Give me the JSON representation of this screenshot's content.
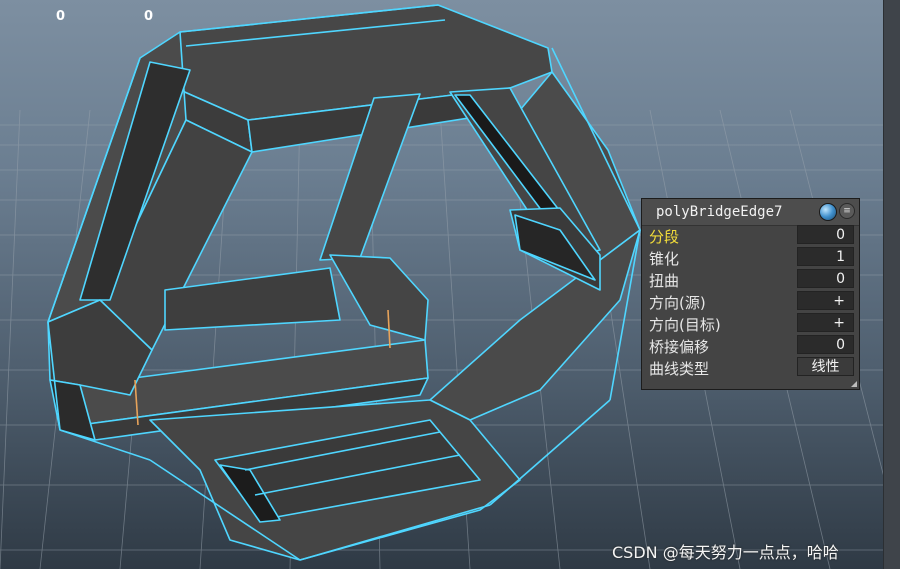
{
  "hud": {
    "left_value": "0",
    "right_value": "0"
  },
  "channel_box": {
    "title": "polyBridgeEdge7",
    "attributes": [
      {
        "label": "分段",
        "value": "0"
      },
      {
        "label": "锥化",
        "value": "1"
      },
      {
        "label": "扭曲",
        "value": "0"
      },
      {
        "label": "方向(源)",
        "value": "+"
      },
      {
        "label": "方向(目标)",
        "value": "+"
      },
      {
        "label": "桥接偏移",
        "value": "0"
      },
      {
        "label": "曲线类型",
        "value": "线性"
      }
    ]
  },
  "colors": {
    "selection_wire": "#4fd6ff",
    "mesh_face": "#4a4a4a",
    "highlight_label": "#f2dc3a"
  },
  "watermark": "CSDN @每天努力一点点，哈哈"
}
